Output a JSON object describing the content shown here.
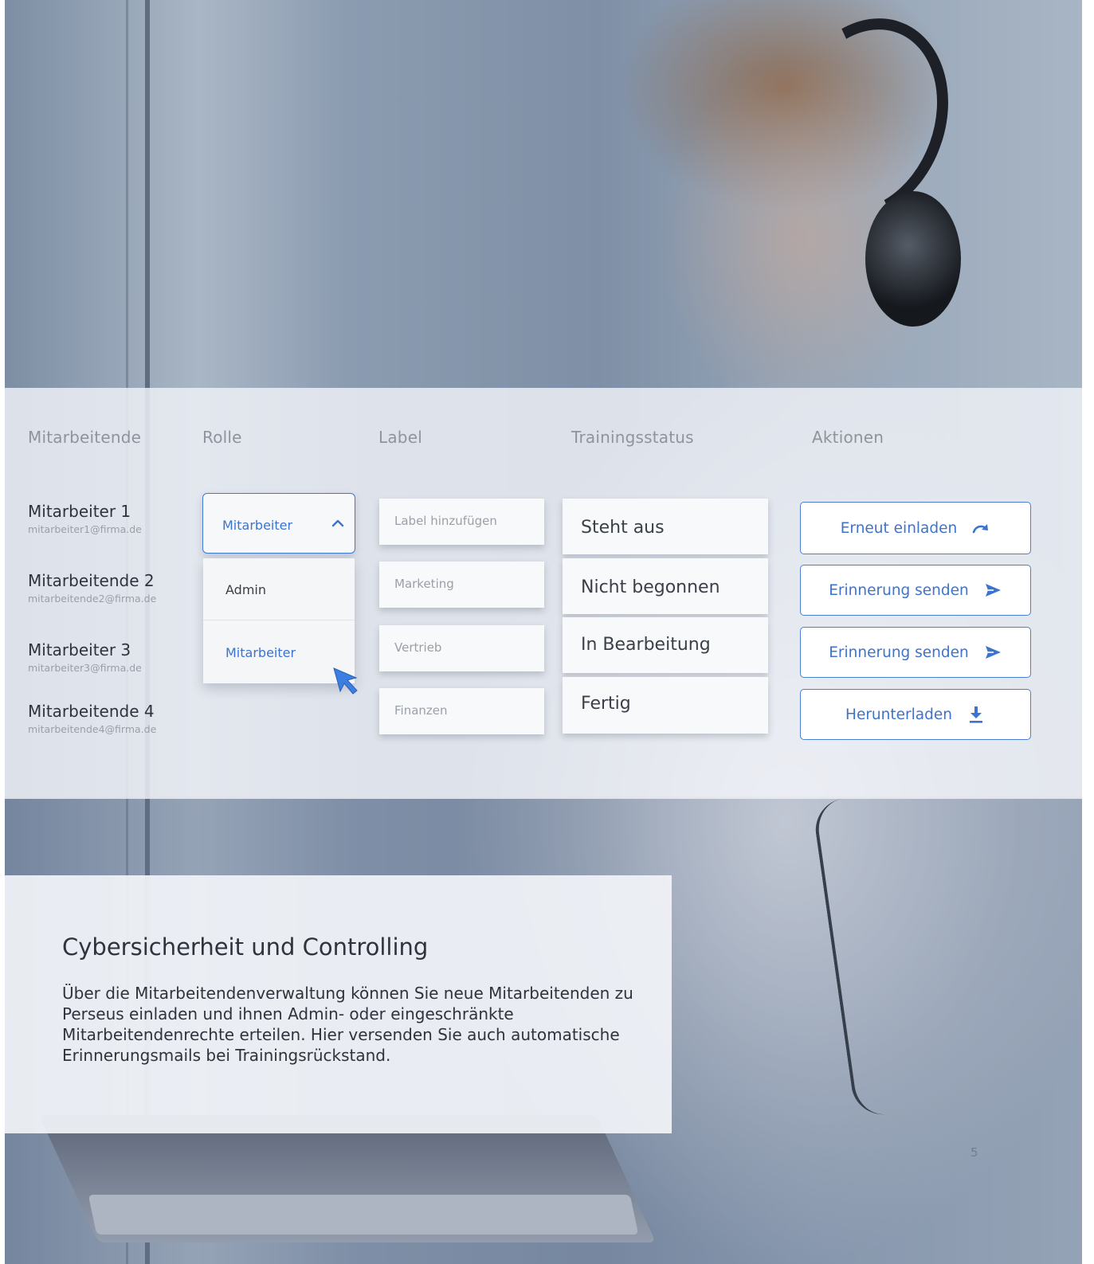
{
  "table": {
    "headers": {
      "employees": "Mitarbeitende",
      "role": "Rolle",
      "label": "Label",
      "training_status": "Trainingsstatus",
      "actions": "Aktionen"
    },
    "employees": [
      {
        "name": "Mitarbeiter 1",
        "email": "mitarbeiter1@firma.de"
      },
      {
        "name": "Mitarbeitende 2",
        "email": "mitarbeitende2@firma.de"
      },
      {
        "name": "Mitarbeiter 3",
        "email": "mitarbeiter3@firma.de"
      },
      {
        "name": "Mitarbeitende 4",
        "email": "mitarbeitende4@firma.de"
      }
    ],
    "role_select": {
      "selected": "Mitarbeiter",
      "options": [
        "Admin",
        "Mitarbeiter"
      ],
      "highlighted_option": "Mitarbeiter"
    },
    "labels": [
      "Label hinzufügen",
      "Marketing",
      "Vertrieb",
      "Finanzen"
    ],
    "statuses": [
      "Steht aus",
      "Nicht begonnen",
      "In Bearbeitung",
      "Fertig"
    ],
    "actions": [
      {
        "label": "Erneut einladen",
        "icon": "redo-arrow-icon"
      },
      {
        "label": "Erinnerung senden",
        "icon": "send-icon"
      },
      {
        "label": "Erinnerung senden",
        "icon": "send-icon"
      },
      {
        "label": "Herunterladen",
        "icon": "download-icon"
      }
    ]
  },
  "card": {
    "title": "Cybersicherheit und Controlling",
    "body": "Über die Mitarbeitendenverwaltung können Sie neue Mitarbeitenden zu Perseus einladen und ihnen Admin- oder eingeschränkte Mitarbeitendenrechte erteilen. Hier versenden Sie auch automatische Erinnerungsmails bei Trainingsrückstand."
  },
  "page_number": "5",
  "colors": {
    "accent": "#3d73cc",
    "text_dark": "#2e333d",
    "text_muted": "#9aa0a8"
  }
}
